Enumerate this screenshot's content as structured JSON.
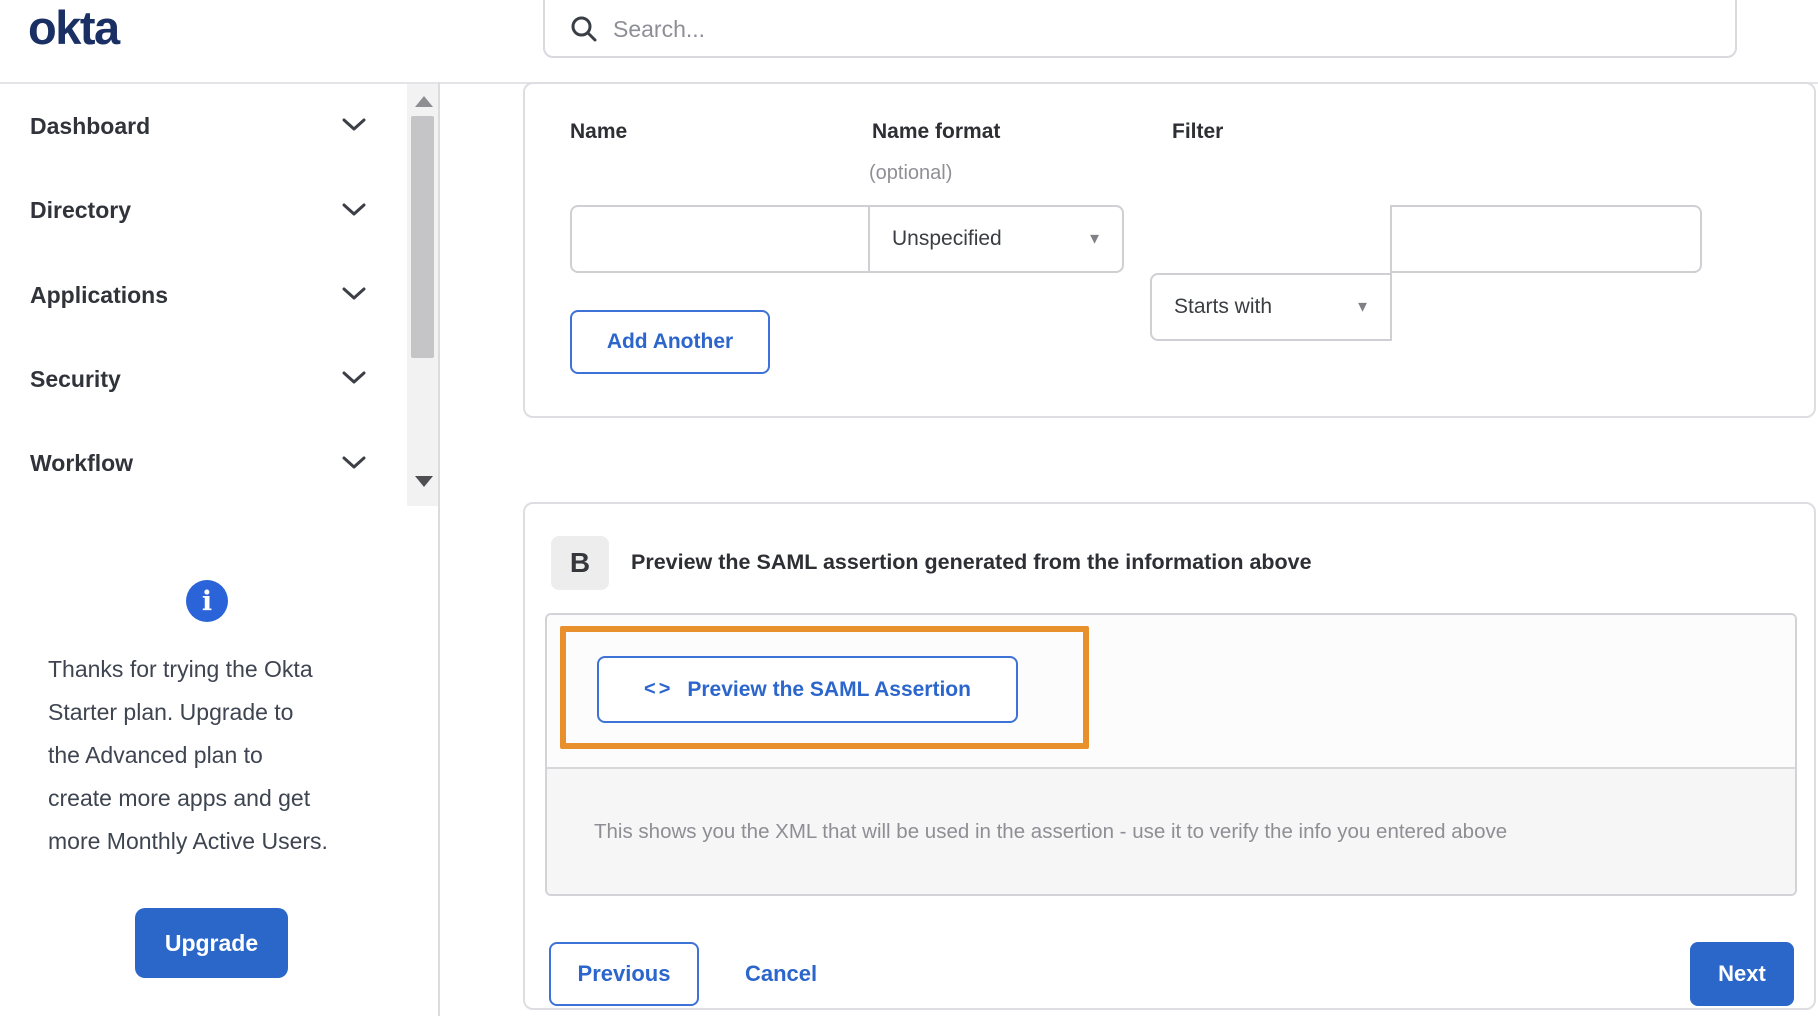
{
  "brand": {
    "logo_text": "okta",
    "navy": "#1a2f64",
    "blue_fill": "#2b67c8",
    "blue_text": "#2c66cc",
    "highlight_orange": "#e8912c"
  },
  "header": {
    "search_placeholder": "Search..."
  },
  "sidebar": {
    "items": [
      {
        "label": "Dashboard"
      },
      {
        "label": "Directory"
      },
      {
        "label": "Applications"
      },
      {
        "label": "Security"
      },
      {
        "label": "Workflow"
      }
    ],
    "promo": {
      "lines": [
        "Thanks for trying the Okta",
        "Starter plan. Upgrade to",
        "the Advanced plan to",
        "create more apps and get",
        "more Monthly Active Users."
      ],
      "button_label": "Upgrade"
    }
  },
  "form": {
    "name_label": "Name",
    "name_format_label": "Name format",
    "name_format_hint": "(optional)",
    "filter_label": "Filter",
    "name_value": "",
    "name_format_value": "Unspecified",
    "filter_operator_value": "Starts with",
    "filter_value": "",
    "add_another_label": "Add Another"
  },
  "section_b": {
    "badge": "B",
    "title": "Preview the SAML assertion generated from the information above",
    "preview_button_icon_glyph": "<>",
    "preview_button_label": "Preview the SAML Assertion",
    "description": "This shows you the XML that will be used in the assertion - use it to verify the info you entered above"
  },
  "footer": {
    "previous_label": "Previous",
    "cancel_label": "Cancel",
    "next_label": "Next"
  },
  "icons": {
    "select_caret_glyph": "▼",
    "info_glyph": "i"
  }
}
